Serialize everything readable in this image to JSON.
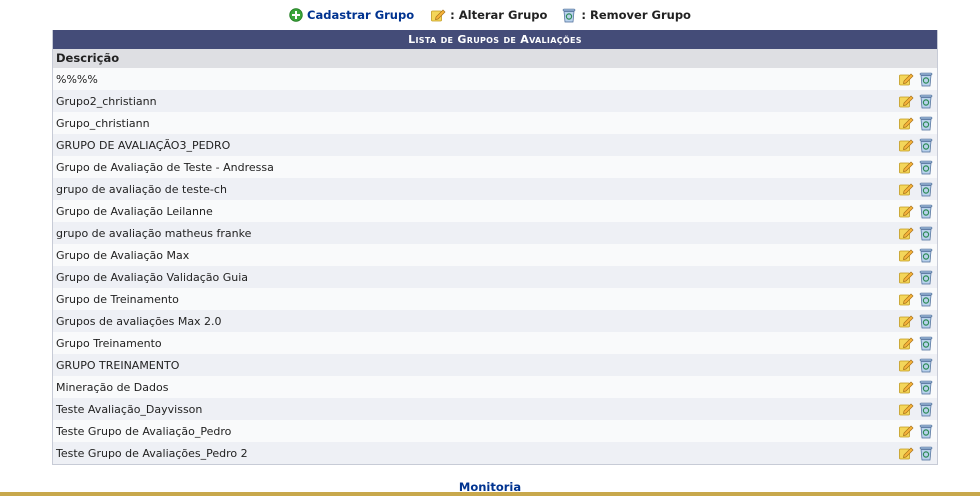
{
  "legend": {
    "add_label": "Cadastrar Grupo",
    "edit_label": ": Alterar Grupo",
    "remove_label": ": Remover Grupo"
  },
  "table": {
    "caption": "Lista de Grupos de Avaliações",
    "column_header": "Descrição",
    "rows": [
      "%%%%",
      "Grupo2_christiann",
      "Grupo_christiann",
      "GRUPO DE AVALIAÇÃO3_PEDRO",
      "Grupo de Avaliação de Teste - Andressa",
      "grupo de avaliação de teste-ch",
      "Grupo de Avaliação Leilanne",
      "grupo de avaliação matheus franke",
      "Grupo de Avaliação Max",
      "Grupo de Avaliação Validação Guia",
      "Grupo de Treinamento",
      "Grupos de avaliações Max 2.0",
      "Grupo Treinamento",
      "GRUPO TREINAMENTO",
      "Mineração de Dados",
      "Teste Avaliação_Dayvisson",
      "Teste Grupo de Avaliação_Pedro",
      "Teste Grupo de Avaliações_Pedro 2"
    ]
  },
  "footer": {
    "link": "Monitoria"
  },
  "icons": {
    "add": "plus-circle-icon",
    "edit": "edit-pencil-icon",
    "remove": "recycle-bin-icon"
  },
  "colors": {
    "caption_bg": "#444c78",
    "link": "#003390",
    "footer_bar": "#c8a84c"
  }
}
